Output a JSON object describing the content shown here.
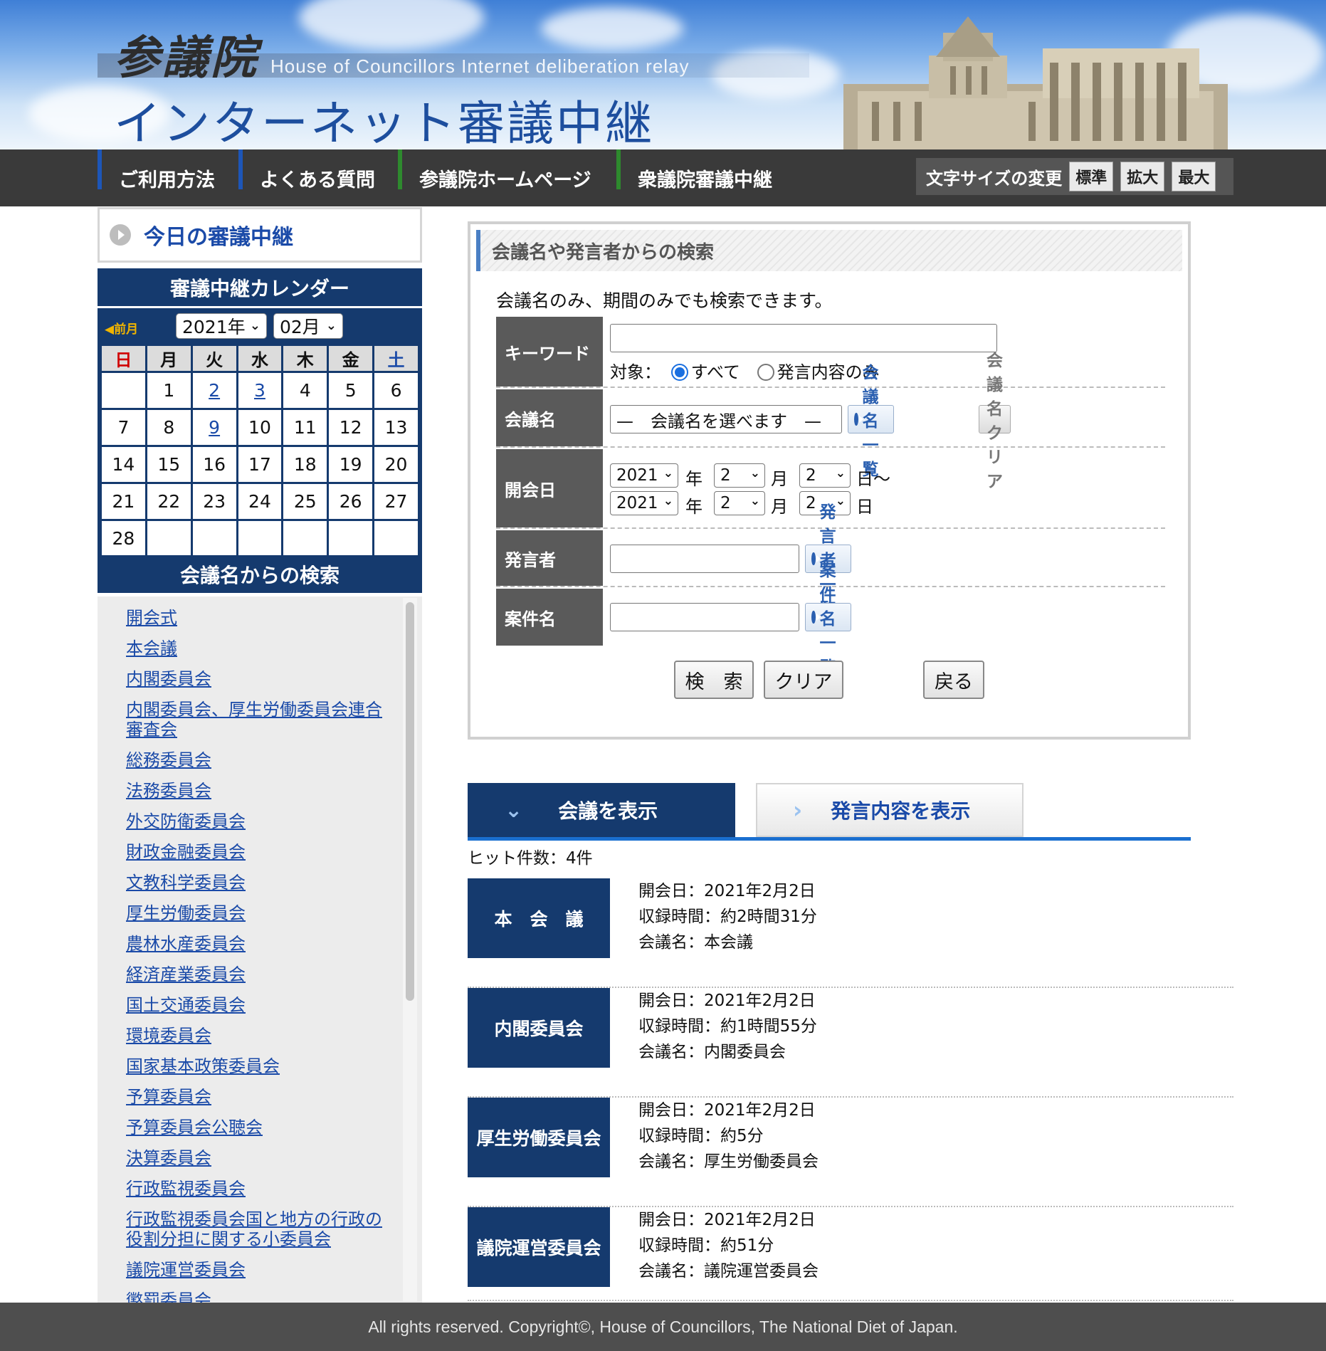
{
  "header": {
    "logo_kanji": "参議院",
    "logo_english": "House of Councillors Internet deliberation relay",
    "logo_title": "インターネット審議中継"
  },
  "nav": {
    "items": [
      "ご利用方法",
      "よくある質問",
      "参議院ホームページ",
      "衆議院審議中継"
    ],
    "font_size_label": "文字サイズの変更",
    "font_sizes": [
      "標準",
      "拡大",
      "最大"
    ]
  },
  "sidebar": {
    "today_title": "今日の審議中継",
    "calendar_title": "審議中継カレンダー",
    "prev_month": "◀前月",
    "year_value": "2021年",
    "month_value": "02月",
    "weekdays": [
      "日",
      "月",
      "火",
      "水",
      "木",
      "金",
      "土"
    ],
    "weeks": [
      [
        "",
        "1",
        "2",
        "3",
        "4",
        "5",
        "6"
      ],
      [
        "7",
        "8",
        "9",
        "10",
        "11",
        "12",
        "13"
      ],
      [
        "14",
        "15",
        "16",
        "17",
        "18",
        "19",
        "20"
      ],
      [
        "21",
        "22",
        "23",
        "24",
        "25",
        "26",
        "27"
      ],
      [
        "28",
        "",
        "",
        "",
        "",
        "",
        ""
      ]
    ],
    "linked_days": [
      "2",
      "3",
      "9"
    ],
    "meeting_search_title": "会議名からの検索",
    "meetings": [
      "開会式",
      "本会議",
      "内閣委員会",
      "内閣委員会、厚生労働委員会連合審査会",
      "総務委員会",
      "法務委員会",
      "外交防衛委員会",
      "財政金融委員会",
      "文教科学委員会",
      "厚生労働委員会",
      "農林水産委員会",
      "経済産業委員会",
      "国土交通委員会",
      "環境委員会",
      "国家基本政策委員会",
      "予算委員会",
      "予算委員会公聴会",
      "決算委員会",
      "行政監視委員会",
      "行政監視委員会国と地方の行政の役割分担に関する小委員会",
      "議院運営委員会",
      "懲罰委員会"
    ]
  },
  "search": {
    "title": "会議名や発言者からの検索",
    "note": "会議名のみ、期間のみでも検索できます。",
    "keyword_label": "キーワード",
    "keyword_value": "",
    "target_label": "対象：",
    "target_all": "すべて",
    "target_speech": "発言内容のみ",
    "meeting_label": "会議名",
    "meeting_placeholder": "—　会議名を選べます　—",
    "meeting_list_button": "会議名一覧",
    "meeting_clear_button": "会議名クリア",
    "date_label": "開会日",
    "from": {
      "year": "2021",
      "month": "2",
      "day": "2"
    },
    "to": {
      "year": "2021",
      "month": "2",
      "day": "2"
    },
    "unit_year": "年",
    "unit_month": "月",
    "unit_day_from": "日〜",
    "unit_day_to": "日",
    "speaker_label": "発言者",
    "speaker_list_button": "発言者一覧",
    "bill_label": "案件名",
    "bill_list_button": "案件名一覧",
    "search_button": "検　索",
    "clear_button": "クリア",
    "back_button": "戻る"
  },
  "tabs": {
    "meeting_tab": "会議を表示",
    "speech_tab": "発言内容を表示"
  },
  "results": {
    "hit_count": "ヒット件数：4件",
    "items": [
      {
        "badge": "本　会　議",
        "date": "開会日：2021年2月2日",
        "duration": "収録時間：約2時間31分",
        "name": "会議名：本会議"
      },
      {
        "badge": "内閣委員会",
        "date": "開会日：2021年2月2日",
        "duration": "収録時間：約1時間55分",
        "name": "会議名：内閣委員会"
      },
      {
        "badge": "厚生労働委員会",
        "date": "開会日：2021年2月2日",
        "duration": "収録時間：約5分",
        "name": "会議名：厚生労働委員会"
      },
      {
        "badge": "議院運営委員会",
        "date": "開会日：2021年2月2日",
        "duration": "収録時間：約51分",
        "name": "会議名：議院運営委員会"
      }
    ]
  },
  "footer": {
    "copyright": "All rights reserved. Copyright©, House of Councillors, The National Diet of Japan."
  }
}
